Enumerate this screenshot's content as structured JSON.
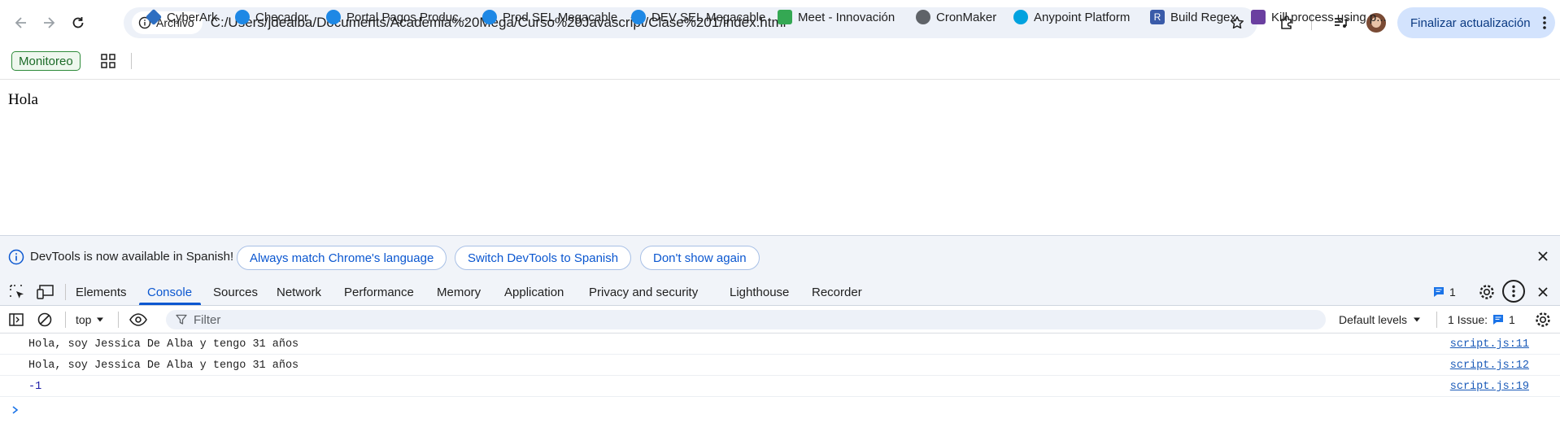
{
  "browser": {
    "chip_label": "Archivo",
    "url": "C:/Users/jdealba/Documents/Academia%20Mega/Curso%20Javascript/Clase%201/index.html",
    "update_button": "Finalizar actualización"
  },
  "bookmarks": {
    "monitoreo": "Monitoreo",
    "items": [
      {
        "label": "CyberArk",
        "color": "#2d6ec1"
      },
      {
        "label": "Checador",
        "color": "#1e88e5"
      },
      {
        "label": "Portal Pagos Produc...",
        "color": "#1e88e5"
      },
      {
        "label": "Prod SEL Megacable",
        "color": "#1e88e5"
      },
      {
        "label": "DEV SEL Megacable",
        "color": "#1e88e5"
      },
      {
        "label": "Meet - Innovación",
        "color": "#34a853"
      },
      {
        "label": "CronMaker",
        "color": "#5f6368"
      },
      {
        "label": "Anypoint Platform",
        "color": "#00a2df"
      },
      {
        "label": "Build Regex",
        "color": "#3a5ba9"
      },
      {
        "label": "Kill process using p...",
        "color": "#6a3fa0"
      }
    ]
  },
  "page": {
    "text": "Hola"
  },
  "devtools": {
    "infobar": {
      "text": "DevTools is now available in Spanish!",
      "btn_match": "Always match Chrome's language",
      "btn_switch": "Switch DevTools to Spanish",
      "btn_dont": "Don't show again"
    },
    "tabs": [
      "Elements",
      "Console",
      "Sources",
      "Network",
      "Performance",
      "Memory",
      "Application",
      "Privacy and security",
      "Lighthouse",
      "Recorder"
    ],
    "messages_badge": "1",
    "console_toolbar": {
      "context": "top",
      "filter_placeholder": "Filter",
      "levels": "Default levels",
      "issues": "1 Issue:",
      "issues_count": "1"
    },
    "console_lines": [
      {
        "text": "Hola, soy Jessica De Alba y tengo 31 años",
        "source": "script.js:11"
      },
      {
        "text": "Hola, soy Jessica De Alba y tengo 31 años",
        "source": "script.js:12"
      },
      {
        "text": "-1",
        "source": "script.js:19"
      }
    ]
  }
}
